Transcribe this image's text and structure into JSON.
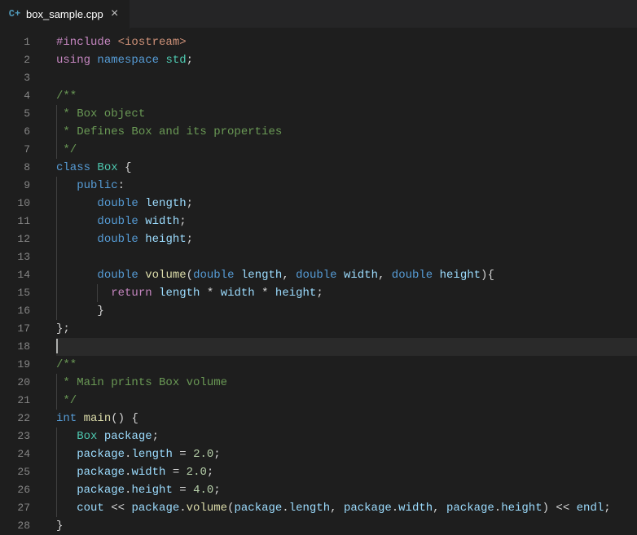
{
  "tab": {
    "icon_label": "C+",
    "filename": "box_sample.cpp",
    "close": "×"
  },
  "editor": {
    "current_line": 18,
    "lines": [
      {
        "n": 1,
        "tokens": [
          [
            "tk-preproc",
            "#include"
          ],
          [
            "tk-default",
            " "
          ],
          [
            "tk-incpath",
            "<iostream>"
          ]
        ]
      },
      {
        "n": 2,
        "tokens": [
          [
            "tk-using",
            "using"
          ],
          [
            "tk-default",
            " "
          ],
          [
            "tk-namespace",
            "namespace"
          ],
          [
            "tk-default",
            " "
          ],
          [
            "tk-ident",
            "std"
          ],
          [
            "tk-default",
            ";"
          ]
        ]
      },
      {
        "n": 3,
        "tokens": []
      },
      {
        "n": 4,
        "tokens": [
          [
            "tk-comment",
            "/**"
          ]
        ]
      },
      {
        "n": 5,
        "tokens": [
          [
            "tk-comment",
            " * Box object"
          ]
        ],
        "guides": [
          0
        ]
      },
      {
        "n": 6,
        "tokens": [
          [
            "tk-comment",
            " * Defines Box and its properties"
          ]
        ],
        "guides": [
          0
        ]
      },
      {
        "n": 7,
        "tokens": [
          [
            "tk-comment",
            " */"
          ]
        ],
        "guides": [
          0
        ]
      },
      {
        "n": 8,
        "tokens": [
          [
            "tk-class",
            "class"
          ],
          [
            "tk-default",
            " "
          ],
          [
            "tk-classname",
            "Box"
          ],
          [
            "tk-default",
            " {"
          ]
        ]
      },
      {
        "n": 9,
        "tokens": [
          [
            "tk-default",
            "   "
          ],
          [
            "tk-public",
            "public"
          ],
          [
            "tk-default",
            ":"
          ]
        ],
        "guides": [
          0
        ]
      },
      {
        "n": 10,
        "tokens": [
          [
            "tk-default",
            "      "
          ],
          [
            "tk-type",
            "double"
          ],
          [
            "tk-default",
            " "
          ],
          [
            "tk-var",
            "length"
          ],
          [
            "tk-default",
            ";"
          ]
        ],
        "guides": [
          0
        ]
      },
      {
        "n": 11,
        "tokens": [
          [
            "tk-default",
            "      "
          ],
          [
            "tk-type",
            "double"
          ],
          [
            "tk-default",
            " "
          ],
          [
            "tk-var",
            "width"
          ],
          [
            "tk-default",
            ";"
          ]
        ],
        "guides": [
          0
        ]
      },
      {
        "n": 12,
        "tokens": [
          [
            "tk-default",
            "      "
          ],
          [
            "tk-type",
            "double"
          ],
          [
            "tk-default",
            " "
          ],
          [
            "tk-var",
            "height"
          ],
          [
            "tk-default",
            ";"
          ]
        ],
        "guides": [
          0
        ]
      },
      {
        "n": 13,
        "tokens": [],
        "guides": [
          0
        ]
      },
      {
        "n": 14,
        "tokens": [
          [
            "tk-default",
            "      "
          ],
          [
            "tk-type",
            "double"
          ],
          [
            "tk-default",
            " "
          ],
          [
            "tk-func",
            "volume"
          ],
          [
            "tk-default",
            "("
          ],
          [
            "tk-type",
            "double"
          ],
          [
            "tk-default",
            " "
          ],
          [
            "tk-var",
            "length"
          ],
          [
            "tk-default",
            ", "
          ],
          [
            "tk-type",
            "double"
          ],
          [
            "tk-default",
            " "
          ],
          [
            "tk-var",
            "width"
          ],
          [
            "tk-default",
            ", "
          ],
          [
            "tk-type",
            "double"
          ],
          [
            "tk-default",
            " "
          ],
          [
            "tk-var",
            "height"
          ],
          [
            "tk-default",
            "){"
          ]
        ],
        "guides": [
          0
        ]
      },
      {
        "n": 15,
        "tokens": [
          [
            "tk-default",
            "        "
          ],
          [
            "tk-return",
            "return"
          ],
          [
            "tk-default",
            " "
          ],
          [
            "tk-var",
            "length"
          ],
          [
            "tk-default",
            " * "
          ],
          [
            "tk-var",
            "width"
          ],
          [
            "tk-default",
            " * "
          ],
          [
            "tk-var",
            "height"
          ],
          [
            "tk-default",
            ";"
          ]
        ],
        "guides": [
          0,
          6
        ]
      },
      {
        "n": 16,
        "tokens": [
          [
            "tk-default",
            "      }"
          ]
        ],
        "guides": [
          0
        ]
      },
      {
        "n": 17,
        "tokens": [
          [
            "tk-default",
            "};"
          ]
        ]
      },
      {
        "n": 18,
        "tokens": [],
        "cursor": true
      },
      {
        "n": 19,
        "tokens": [
          [
            "tk-comment",
            "/**"
          ]
        ]
      },
      {
        "n": 20,
        "tokens": [
          [
            "tk-comment",
            " * Main prints Box volume"
          ]
        ],
        "guides": [
          0
        ]
      },
      {
        "n": 21,
        "tokens": [
          [
            "tk-comment",
            " */"
          ]
        ],
        "guides": [
          0
        ]
      },
      {
        "n": 22,
        "tokens": [
          [
            "tk-type",
            "int"
          ],
          [
            "tk-default",
            " "
          ],
          [
            "tk-func",
            "main"
          ],
          [
            "tk-default",
            "() {"
          ]
        ]
      },
      {
        "n": 23,
        "tokens": [
          [
            "tk-default",
            "   "
          ],
          [
            "tk-classname",
            "Box"
          ],
          [
            "tk-default",
            " "
          ],
          [
            "tk-var",
            "package"
          ],
          [
            "tk-default",
            ";"
          ]
        ],
        "guides": [
          0
        ]
      },
      {
        "n": 24,
        "tokens": [
          [
            "tk-default",
            "   "
          ],
          [
            "tk-var",
            "package"
          ],
          [
            "tk-default",
            "."
          ],
          [
            "tk-prop",
            "length"
          ],
          [
            "tk-default",
            " = "
          ],
          [
            "tk-num",
            "2.0"
          ],
          [
            "tk-default",
            ";"
          ]
        ],
        "guides": [
          0
        ]
      },
      {
        "n": 25,
        "tokens": [
          [
            "tk-default",
            "   "
          ],
          [
            "tk-var",
            "package"
          ],
          [
            "tk-default",
            "."
          ],
          [
            "tk-prop",
            "width"
          ],
          [
            "tk-default",
            " = "
          ],
          [
            "tk-num",
            "2.0"
          ],
          [
            "tk-default",
            ";"
          ]
        ],
        "guides": [
          0
        ]
      },
      {
        "n": 26,
        "tokens": [
          [
            "tk-default",
            "   "
          ],
          [
            "tk-var",
            "package"
          ],
          [
            "tk-default",
            "."
          ],
          [
            "tk-prop",
            "height"
          ],
          [
            "tk-default",
            " = "
          ],
          [
            "tk-num",
            "4.0"
          ],
          [
            "tk-default",
            ";"
          ]
        ],
        "guides": [
          0
        ]
      },
      {
        "n": 27,
        "tokens": [
          [
            "tk-default",
            "   "
          ],
          [
            "tk-var",
            "cout"
          ],
          [
            "tk-default",
            " << "
          ],
          [
            "tk-var",
            "package"
          ],
          [
            "tk-default",
            "."
          ],
          [
            "tk-func",
            "volume"
          ],
          [
            "tk-default",
            "("
          ],
          [
            "tk-var",
            "package"
          ],
          [
            "tk-default",
            "."
          ],
          [
            "tk-prop",
            "length"
          ],
          [
            "tk-default",
            ", "
          ],
          [
            "tk-var",
            "package"
          ],
          [
            "tk-default",
            "."
          ],
          [
            "tk-prop",
            "width"
          ],
          [
            "tk-default",
            ", "
          ],
          [
            "tk-var",
            "package"
          ],
          [
            "tk-default",
            "."
          ],
          [
            "tk-prop",
            "height"
          ],
          [
            "tk-default",
            ") << "
          ],
          [
            "tk-var",
            "endl"
          ],
          [
            "tk-default",
            ";"
          ]
        ],
        "guides": [
          0
        ]
      },
      {
        "n": 28,
        "tokens": [
          [
            "tk-default",
            "}"
          ]
        ]
      }
    ]
  }
}
